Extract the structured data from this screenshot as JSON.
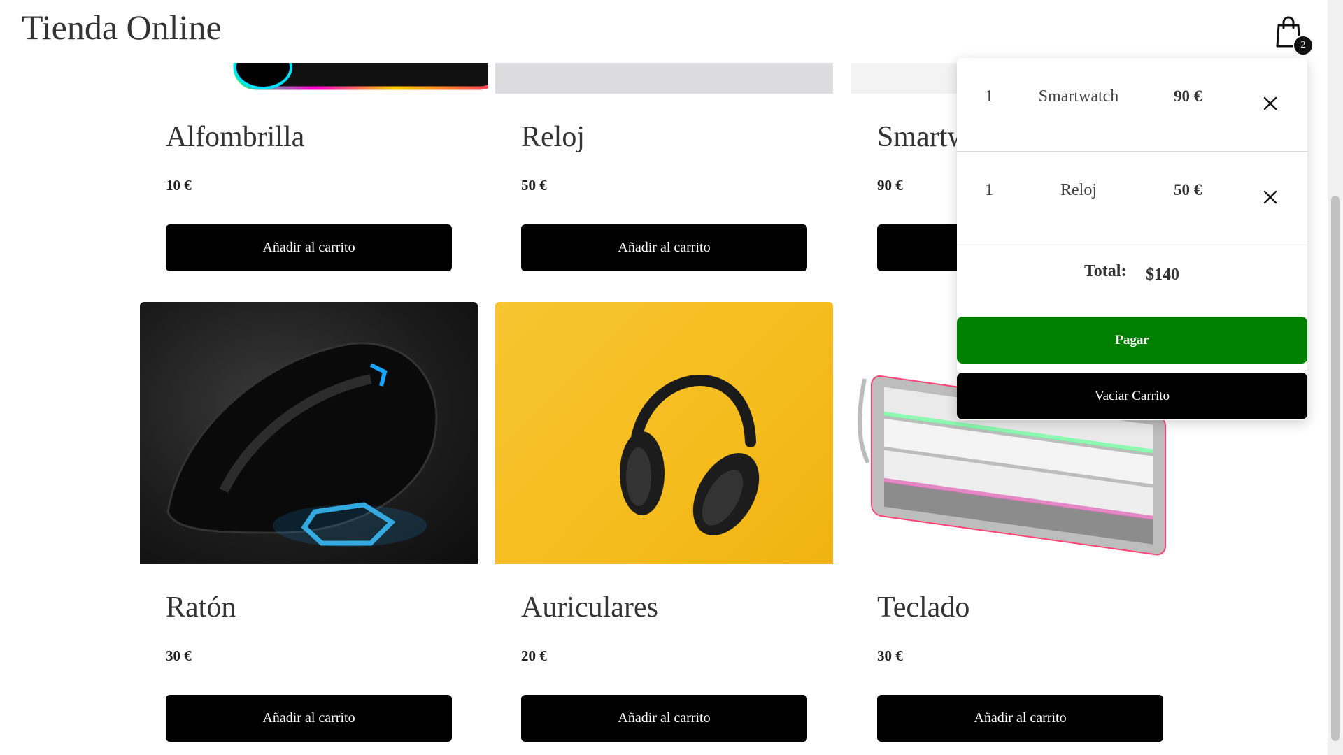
{
  "header": {
    "title": "Tienda Online",
    "cart_count": "2"
  },
  "products": [
    {
      "name": "Alfombrilla",
      "price": "10 €",
      "add_label": "Añadir al carrito"
    },
    {
      "name": "Reloj",
      "price": "50 €",
      "add_label": "Añadir al carrito"
    },
    {
      "name": "Smartwatch",
      "price": "90 €",
      "add_label": "Añadir al carrito"
    },
    {
      "name": "Ratón",
      "price": "30 €",
      "add_label": "Añadir al carrito"
    },
    {
      "name": "Auriculares",
      "price": "20 €",
      "add_label": "Añadir al carrito"
    },
    {
      "name": "Teclado",
      "price": "30 €",
      "add_label": "Añadir al carrito"
    }
  ],
  "cart": {
    "items": [
      {
        "qty": "1",
        "name": "Smartwatch",
        "price": "90 €"
      },
      {
        "qty": "1",
        "name": "Reloj",
        "price": "50 €"
      }
    ],
    "total_label": "Total:",
    "total_value": "$140",
    "pay_label": "Pagar",
    "empty_label": "Vaciar Carrito"
  },
  "colors": {
    "pay_button": "#008000",
    "primary_button": "#000000"
  },
  "icons": {
    "cart": "shopping-bag-icon",
    "remove": "close-icon"
  }
}
